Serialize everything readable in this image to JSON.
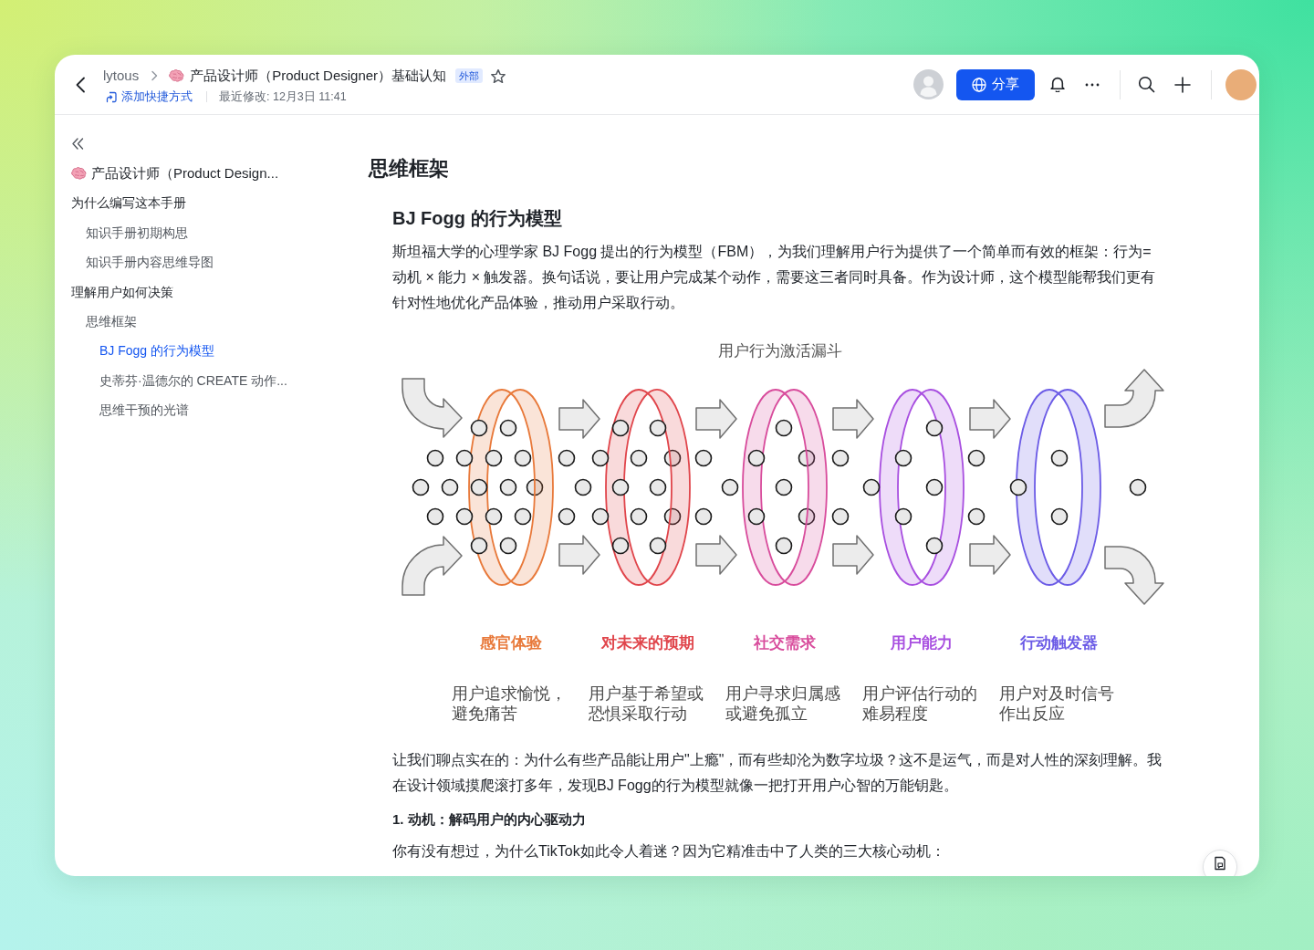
{
  "header": {
    "breadcrumb": {
      "root": "lytous",
      "title": "产品设计师（Product Designer）基础认知",
      "badge": "外部",
      "starred": false
    },
    "shortcut_link": "添加快捷方式",
    "last_modified": "最近修改: 12月3日 11:41",
    "share_button": "分享"
  },
  "sidebar": {
    "doc_title": "产品设计师（Product Design...",
    "outline": [
      {
        "text": "为什么编写这本手册",
        "selected": false,
        "children": [
          {
            "text": "知识手册初期构思",
            "selected": false
          },
          {
            "text": "知识手册内容思维导图",
            "selected": false
          }
        ]
      },
      {
        "text": "理解用户如何决策",
        "selected": false,
        "children": [
          {
            "text": "思维框架",
            "selected": false,
            "children": [
              {
                "text": "BJ Fogg 的行为模型",
                "selected": true
              },
              {
                "text": "史蒂芬·温德尔的 CREATE 动作...",
                "selected": false
              },
              {
                "text": "思维干预的光谱",
                "selected": false
              }
            ]
          }
        ]
      }
    ]
  },
  "document": {
    "blocks": [
      {
        "kind": "heading1",
        "text": "思维框架"
      },
      {
        "kind": "heading2",
        "text": "BJ Fogg 的行为模型"
      },
      {
        "kind": "paragraph",
        "text": "斯坦福大学的心理学家 BJ Fogg 提出的行为模型（FBM），为我们理解用户行为提供了一个简单而有效的框架：行为=动机 × 能力 × 触发器。换句话说，要让用户完成某个动作，需要这三者同时具备。作为设计师，这个模型能帮我们更有针对性地优化产品体验，推动用户采取行动。"
      },
      {
        "kind": "figure",
        "title": "用户行为激活漏斗",
        "stages": [
          {
            "title": "感官体验",
            "description": "用户追求愉悦，避免痛苦",
            "color": "#e8793a"
          },
          {
            "title": "对未来的预期",
            "description": "用户基于希望或恐惧采取行动",
            "color": "#e0454b"
          },
          {
            "title": "社交需求",
            "description": "用户寻求归属感或避免孤立",
            "color": "#d84c9c"
          },
          {
            "title": "用户能力",
            "description": "用户评估行动的难易程度",
            "color": "#a84fe0"
          },
          {
            "title": "行动触发器",
            "description": "用户对及时信号作出反应",
            "color": "#6b5be6"
          }
        ]
      },
      {
        "kind": "paragraph",
        "text": "让我们聊点实在的：为什么有些产品能让用户\"上瘾\"，而有些却沦为数字垃圾？这不是运气，而是对人性的深刻理解。我在设计领域摸爬滚打多年，发现BJ Fogg的行为模型就像一把打开用户心智的万能钥匙。"
      },
      {
        "kind": "heading3",
        "text": "1. 动机：解码用户的内心驱动力"
      },
      {
        "kind": "paragraph",
        "text": "你有没有想过，为什么TikTok如此令人着迷？因为它精准击中了人类的三大核心动机："
      }
    ]
  }
}
